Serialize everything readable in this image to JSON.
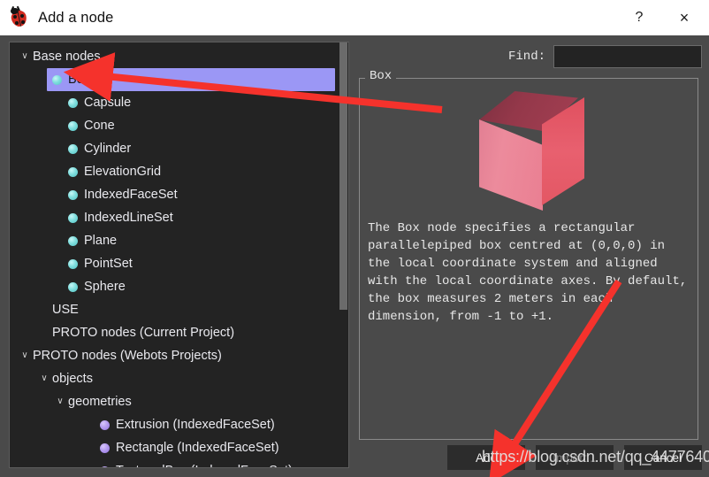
{
  "window": {
    "title": "Add a node",
    "icon": "ladybug-icon",
    "help_label": "?",
    "close_label": "×"
  },
  "tree": {
    "items": [
      {
        "label": "Base nodes",
        "level": 0,
        "twisty": "∨",
        "bullet": "none",
        "selected": false
      },
      {
        "label": "Box",
        "level": 2,
        "twisty": "",
        "bullet": "cyan",
        "selected": true
      },
      {
        "label": "Capsule",
        "level": 2,
        "twisty": "",
        "bullet": "cyan",
        "selected": false
      },
      {
        "label": "Cone",
        "level": 2,
        "twisty": "",
        "bullet": "cyan",
        "selected": false
      },
      {
        "label": "Cylinder",
        "level": 2,
        "twisty": "",
        "bullet": "cyan",
        "selected": false
      },
      {
        "label": "ElevationGrid",
        "level": 2,
        "twisty": "",
        "bullet": "cyan",
        "selected": false
      },
      {
        "label": "IndexedFaceSet",
        "level": 2,
        "twisty": "",
        "bullet": "cyan",
        "selected": false
      },
      {
        "label": "IndexedLineSet",
        "level": 2,
        "twisty": "",
        "bullet": "cyan",
        "selected": false
      },
      {
        "label": "Plane",
        "level": 2,
        "twisty": "",
        "bullet": "cyan",
        "selected": false
      },
      {
        "label": "PointSet",
        "level": 2,
        "twisty": "",
        "bullet": "cyan",
        "selected": false
      },
      {
        "label": "Sphere",
        "level": 2,
        "twisty": "",
        "bullet": "cyan",
        "selected": false
      },
      {
        "label": "USE",
        "level": 1,
        "twisty": "",
        "bullet": "none",
        "selected": false
      },
      {
        "label": "PROTO nodes (Current Project)",
        "level": 1,
        "twisty": "",
        "bullet": "none",
        "selected": false
      },
      {
        "label": "PROTO nodes (Webots Projects)",
        "level": 0,
        "twisty": "∨",
        "bullet": "none",
        "selected": false
      },
      {
        "label": "objects",
        "level": 1,
        "twisty": "∨",
        "bullet": "none",
        "selected": false
      },
      {
        "label": "geometries",
        "level": 2,
        "twisty": "∨",
        "bullet": "none",
        "selected": false
      },
      {
        "label": "Extrusion (IndexedFaceSet)",
        "level": 4,
        "twisty": "",
        "bullet": "purple",
        "selected": false
      },
      {
        "label": "Rectangle (IndexedFaceSet)",
        "level": 4,
        "twisty": "",
        "bullet": "purple",
        "selected": false
      },
      {
        "label": "TexturedBox (IndexedFaceSet)",
        "level": 4,
        "twisty": "",
        "bullet": "purple",
        "selected": false
      }
    ]
  },
  "find": {
    "label": "Find:",
    "value": "",
    "placeholder": ""
  },
  "preview": {
    "legend": "Box",
    "image_alt": "red-cube-render",
    "description": "The Box node specifies a rectangular parallelepiped box centred at (0,0,0) in the local coordinate system and aligned with the local coordinate axes. By default, the box measures 2 meters in each dimension, from -1 to +1."
  },
  "buttons": {
    "add": "Add",
    "import": "Import...",
    "cancel": "Cancel"
  },
  "annotations": {
    "watermark": "https://blog.csdn.net/qq_44776401",
    "arrow_color": "#f5322c"
  },
  "colors": {
    "selection": "#9b97f5",
    "tree_bg": "#232323",
    "dialog_bg": "#4a4a4a",
    "titlebar_bg": "#ffffff",
    "bullet_cyan": "#7fdedd",
    "bullet_purple": "#b49bf0",
    "cube": "#e3606f"
  }
}
